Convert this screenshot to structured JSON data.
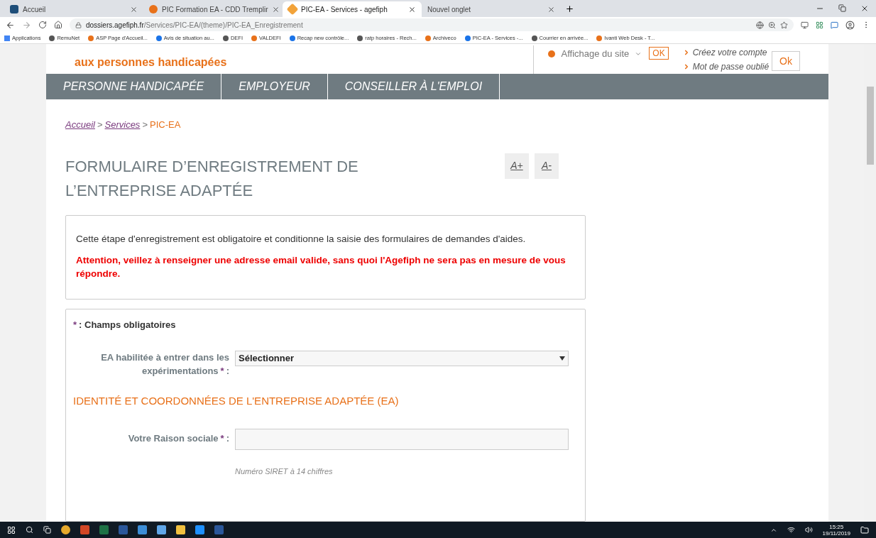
{
  "browser": {
    "tabs": [
      {
        "title": "Accueil",
        "selected": false
      },
      {
        "title": "PIC Formation EA - CDD Tremplir",
        "selected": false
      },
      {
        "title": "PIC-EA - Services - agefiph",
        "selected": true
      },
      {
        "title": "Nouvel onglet",
        "selected": false
      }
    ],
    "address": {
      "host": "dossiers.agefiph.fr",
      "path": "/Services/PIC-EA/(theme)/PIC-EA_Enregistrement"
    },
    "bookmarks": [
      "Applications",
      "RemuNet",
      "ASP Page d'Accueil...",
      "Avis de situation au...",
      "DEFI",
      "VALDEFI",
      "Recap new contrôle...",
      "ratp horaires - Rech...",
      "Archiveco",
      "PIC-EA - Services -...",
      "Courrier en arrivée...",
      "Ivanti Web Desk - T..."
    ]
  },
  "header": {
    "tagline": "aux personnes handicapées",
    "display_label": "Affichage du site",
    "display_ok": "OK",
    "links": [
      "Créez votre compte",
      "Mot de passe oublié"
    ],
    "login_ok": "Ok"
  },
  "nav": [
    {
      "label": "PERSONNE HANDICAPÉE"
    },
    {
      "label": "EMPLOYEUR"
    },
    {
      "label": "CONSEILLER À L'EMPLOI"
    }
  ],
  "breadcrumb": [
    {
      "kind": "link",
      "label": "Accueil"
    },
    {
      "kind": "sep",
      "label": ">"
    },
    {
      "kind": "link",
      "label": "Services"
    },
    {
      "kind": "sep",
      "label": ">"
    },
    {
      "kind": "current",
      "label": "PIC-EA"
    }
  ],
  "title": [
    "FORMULAIRE D’ENREGISTREMENT DE",
    "L’ENTREPRISE ADAPTÉE"
  ],
  "font_buttons": [
    "A+",
    "A-"
  ],
  "notice": {
    "text": "Cette étape d'enregistrement est obligatoire et conditionne la saisie des formulaires de demandes d'aides.",
    "warning": "Attention, veillez à renseigner une adresse email valide, sans quoi l'Agefiph ne sera pas en mesure de vous répondre."
  },
  "form": {
    "required_mark": "*",
    "required_note": ": Champs obligatoires",
    "select": {
      "label": [
        "EA habilitée à entrer dans les",
        "expérimentations"
      ],
      "mark": "*",
      "colon": ":",
      "value": "Sélectionner"
    },
    "section": "IDENTITÉ ET COORDONNÉES DE L'ENTREPRISE ADAPTÉE (EA)",
    "text_field": {
      "label": "Votre Raison sociale",
      "mark": "*",
      "colon": ":"
    },
    "hint": "Numéro SIRET à 14 chiffres"
  },
  "taskbar": {
    "time": "15:25",
    "date": "19/11/2019"
  }
}
